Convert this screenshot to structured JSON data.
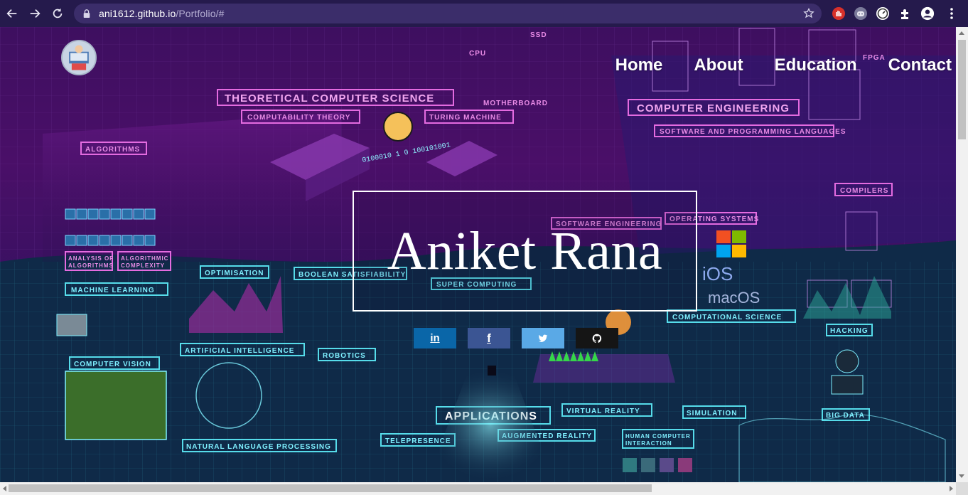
{
  "browser": {
    "url_host": "ani1612.github.io",
    "url_path": "/Portfolio/#",
    "icons": [
      "back-icon",
      "forward-icon",
      "reload-icon",
      "lock-icon",
      "star-icon",
      "extension-icons",
      "puzzle-icon",
      "profile-icon",
      "menu-icon"
    ]
  },
  "nav": {
    "items": [
      {
        "label": "Home"
      },
      {
        "label": "About"
      },
      {
        "label": "Education"
      },
      {
        "label": "Contact"
      }
    ]
  },
  "hero": {
    "name": "Aniket Rana"
  },
  "socials": [
    {
      "name": "linkedin",
      "label": "in",
      "color": "#0a66a8"
    },
    {
      "name": "facebook",
      "label": "f",
      "color": "#3b5593"
    },
    {
      "name": "twitter",
      "color": "#5aa9e6"
    },
    {
      "name": "github",
      "color": "#151515"
    }
  ],
  "background_art": {
    "labels": [
      "THEORETICAL COMPUTER SCIENCE",
      "COMPUTABILITY THEORY",
      "TURING MACHINE",
      "ALGORITHMS",
      "COMPUTER ENGINEERING",
      "SOFTWARE AND PROGRAMMING LANGUAGES",
      "COMPILERS",
      "OPERATING SYSTEMS",
      "SOFTWARE ENGINEERING",
      "MACHINE LEARNING",
      "OPTIMISATION",
      "BOOLEAN SATISFIABILITY",
      "SUPER COMPUTING",
      "COMPUTATIONAL SCIENCE",
      "ARTIFICIAL INTELLIGENCE",
      "ROBOTICS",
      "COMPUTER VISION",
      "HACKING",
      "APPLICATIONS",
      "VIRTUAL REALITY",
      "SIMULATION",
      "BIG DATA",
      "AUGMENTED REALITY",
      "TELEPRESENCE",
      "HUMAN COMPUTER INTERACTION",
      "NATURAL LANGUAGE PROCESSING",
      "MOTHERBOARD",
      "CPU",
      "SSD",
      "FPGA"
    ]
  }
}
